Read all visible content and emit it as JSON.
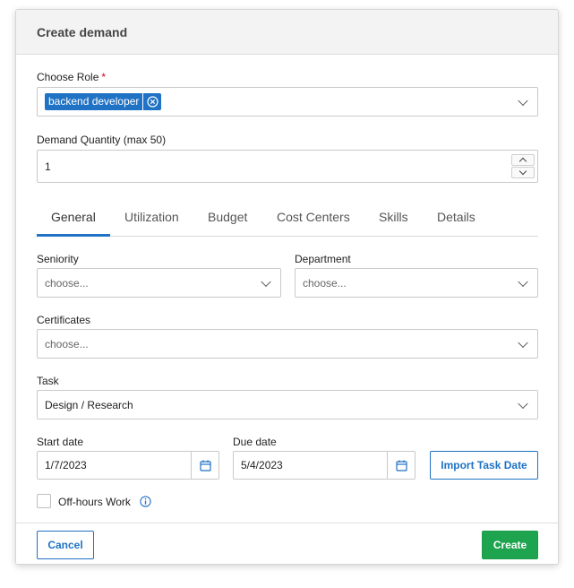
{
  "modal": {
    "title": "Create demand"
  },
  "role": {
    "label": "Choose Role",
    "required_mark": "*",
    "selected_tag": "backend developer"
  },
  "quantity": {
    "label": "Demand Quantity (max 50)",
    "value": "1"
  },
  "tabs": [
    {
      "label": "General",
      "active": true
    },
    {
      "label": "Utilization",
      "active": false
    },
    {
      "label": "Budget",
      "active": false
    },
    {
      "label": "Cost Centers",
      "active": false
    },
    {
      "label": "Skills",
      "active": false
    },
    {
      "label": "Details",
      "active": false
    }
  ],
  "seniority": {
    "label": "Seniority",
    "placeholder": "choose..."
  },
  "department": {
    "label": "Department",
    "placeholder": "choose..."
  },
  "certificates": {
    "label": "Certificates",
    "placeholder": "choose..."
  },
  "task": {
    "label": "Task",
    "value": "Design / Research"
  },
  "start_date": {
    "label": "Start date",
    "value": "1/7/2023"
  },
  "due_date": {
    "label": "Due date",
    "value": "5/4/2023"
  },
  "import_button": {
    "label": "Import Task Date"
  },
  "off_hours": {
    "label": "Off-hours Work",
    "checked": false
  },
  "footer": {
    "cancel_label": "Cancel",
    "create_label": "Create"
  },
  "colors": {
    "accent": "#1f72c4",
    "primary_button": "#1ea44f",
    "required": "#d0021b"
  },
  "icons": {
    "tag_remove": "circle-x-icon",
    "calendar": "calendar-icon",
    "info": "info-icon",
    "dropdown": "chevron-down-icon"
  }
}
